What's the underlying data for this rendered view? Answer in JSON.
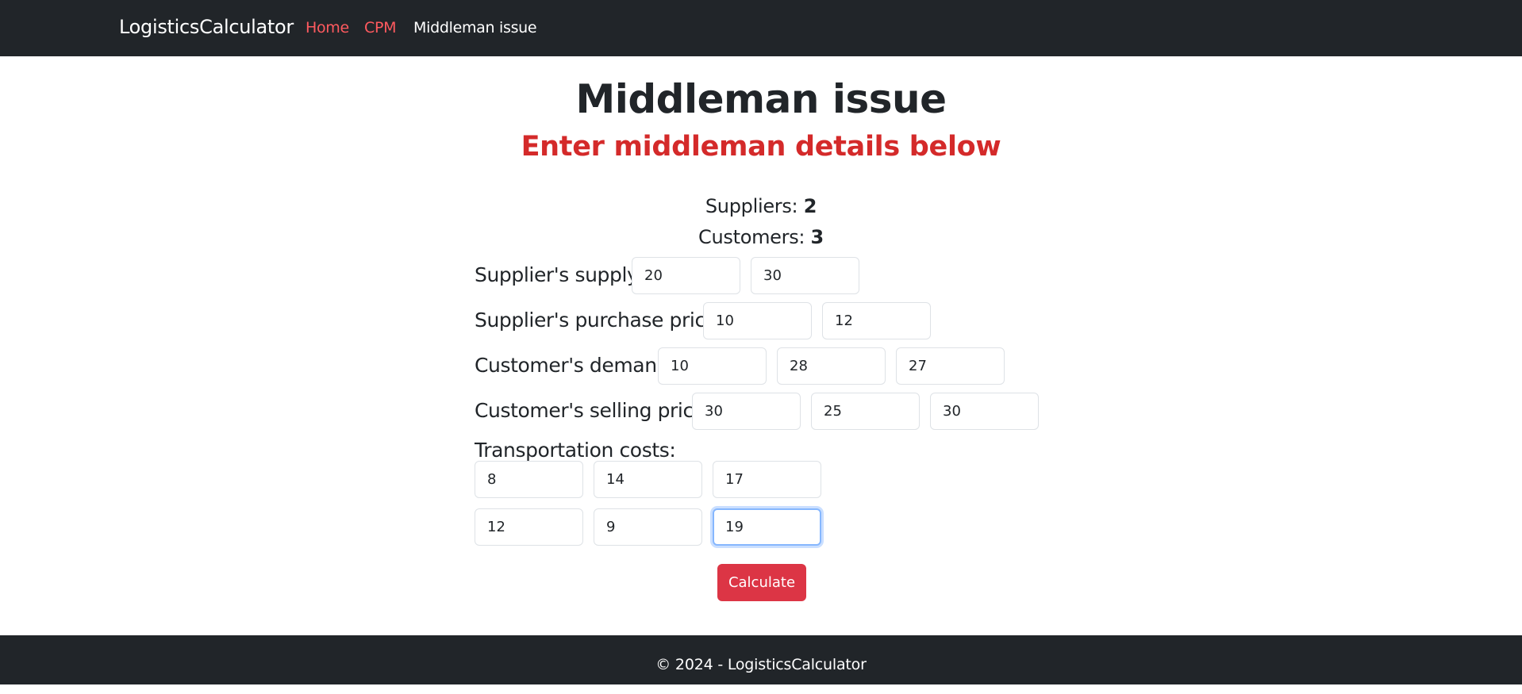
{
  "nav": {
    "brand": "LogisticsCalculator",
    "links": [
      "Home",
      "CPM",
      "Middleman issue"
    ]
  },
  "page": {
    "title": "Middleman issue",
    "subtitle": "Enter middleman details below"
  },
  "counts": {
    "suppliers_label": "Suppliers:",
    "suppliers_value": "2",
    "customers_label": "Customers:",
    "customers_value": "3"
  },
  "form": {
    "supply_label": "Supplier's supply:",
    "supply_values": [
      "20",
      "30"
    ],
    "purchase_label": "Supplier's purchase price:",
    "purchase_values": [
      "10",
      "12"
    ],
    "demand_label": "Customer's demand:",
    "demand_values": [
      "10",
      "28",
      "27"
    ],
    "selling_label": "Customer's selling price:",
    "selling_values": [
      "30",
      "25",
      "30"
    ],
    "transport_label": "Transportation costs:",
    "transport_values": [
      [
        "8",
        "14",
        "17"
      ],
      [
        "12",
        "9",
        "19"
      ]
    ],
    "calculate_label": "Calculate"
  },
  "footer": {
    "text": "© 2024 - LogisticsCalculator"
  },
  "colors": {
    "navbar_bg": "#212529",
    "link_accent": "#ff5a5f",
    "subtitle": "#d42a2a",
    "button": "#dc3545",
    "focus_ring": "#86b7fe"
  }
}
